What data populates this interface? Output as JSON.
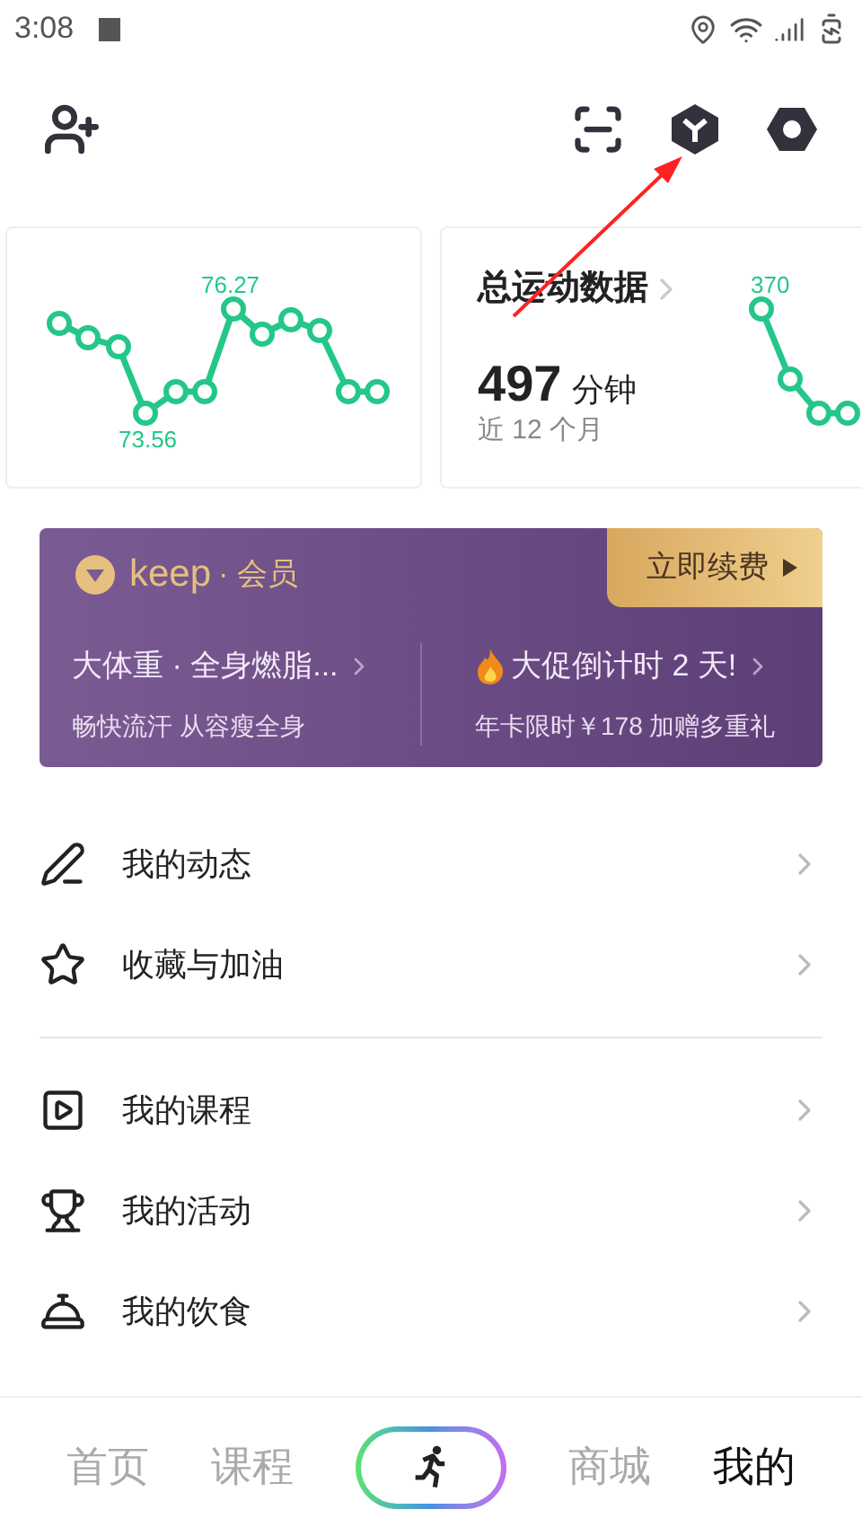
{
  "status_bar": {
    "time": "3:08"
  },
  "weight_card": {
    "max_label": "76.27",
    "min_label": "73.56"
  },
  "exercise_card": {
    "title": "总运动数据",
    "value": "497",
    "unit": "分钟",
    "period": "近 12 个月",
    "peak_label": "370"
  },
  "membership": {
    "brand": "keep",
    "tier": "· 会员",
    "renew_button": "立即续费",
    "promos": [
      {
        "kind": "plain",
        "title": "大体重 · 全身燃脂...",
        "subtitle": "畅快流汗 从容瘦全身"
      },
      {
        "kind": "fire",
        "title": "大促倒计时 2 天!",
        "subtitle": "年卡限时￥178 加赠多重礼"
      }
    ]
  },
  "menu_groups": [
    [
      {
        "kind": "pen",
        "label": "我的动态"
      },
      {
        "kind": "star",
        "label": "收藏与加油"
      }
    ],
    [
      {
        "kind": "play",
        "label": "我的课程"
      },
      {
        "kind": "trophy",
        "label": "我的活动"
      },
      {
        "kind": "bell",
        "label": "我的饮食"
      }
    ]
  ],
  "tabs": [
    {
      "kind": "text",
      "label": "首页",
      "selected": false
    },
    {
      "kind": "text",
      "label": "课程",
      "selected": false
    },
    {
      "kind": "run"
    },
    {
      "kind": "text",
      "label": "商城",
      "selected": false
    },
    {
      "kind": "text",
      "label": "我的",
      "selected": true
    }
  ]
}
